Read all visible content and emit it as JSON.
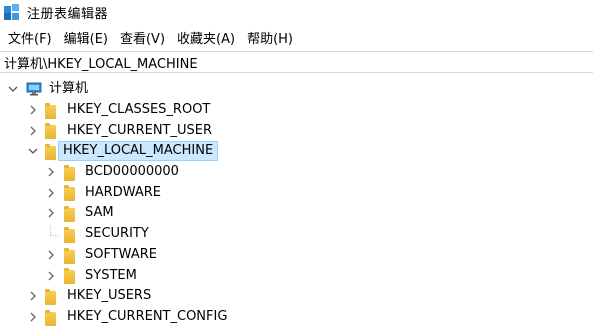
{
  "window": {
    "title": "注册表编辑器"
  },
  "menu": {
    "items": [
      {
        "label": "文件(F)"
      },
      {
        "label": "编辑(E)"
      },
      {
        "label": "查看(V)"
      },
      {
        "label": "收藏夹(A)"
      },
      {
        "label": "帮助(H)"
      }
    ]
  },
  "address": {
    "path": "计算机\\HKEY_LOCAL_MACHINE"
  },
  "tree": {
    "root": {
      "label": "计算机",
      "icon": "computer-icon",
      "expanded": true
    },
    "hives": [
      {
        "label": "HKEY_CLASSES_ROOT",
        "expanded": false
      },
      {
        "label": "HKEY_CURRENT_USER",
        "expanded": false
      },
      {
        "label": "HKEY_LOCAL_MACHINE",
        "expanded": true,
        "selected": true,
        "children": [
          {
            "label": "BCD00000000",
            "has_children": true
          },
          {
            "label": "HARDWARE",
            "has_children": true
          },
          {
            "label": "SAM",
            "has_children": true
          },
          {
            "label": "SECURITY",
            "has_children": false
          },
          {
            "label": "SOFTWARE",
            "has_children": true
          },
          {
            "label": "SYSTEM",
            "has_children": true
          }
        ]
      },
      {
        "label": "HKEY_USERS",
        "expanded": false
      },
      {
        "label": "HKEY_CURRENT_CONFIG",
        "expanded": false
      }
    ]
  },
  "colors": {
    "selection_bg": "#cce8ff",
    "selection_border": "#99d1ff",
    "folder": "#f0c040"
  }
}
